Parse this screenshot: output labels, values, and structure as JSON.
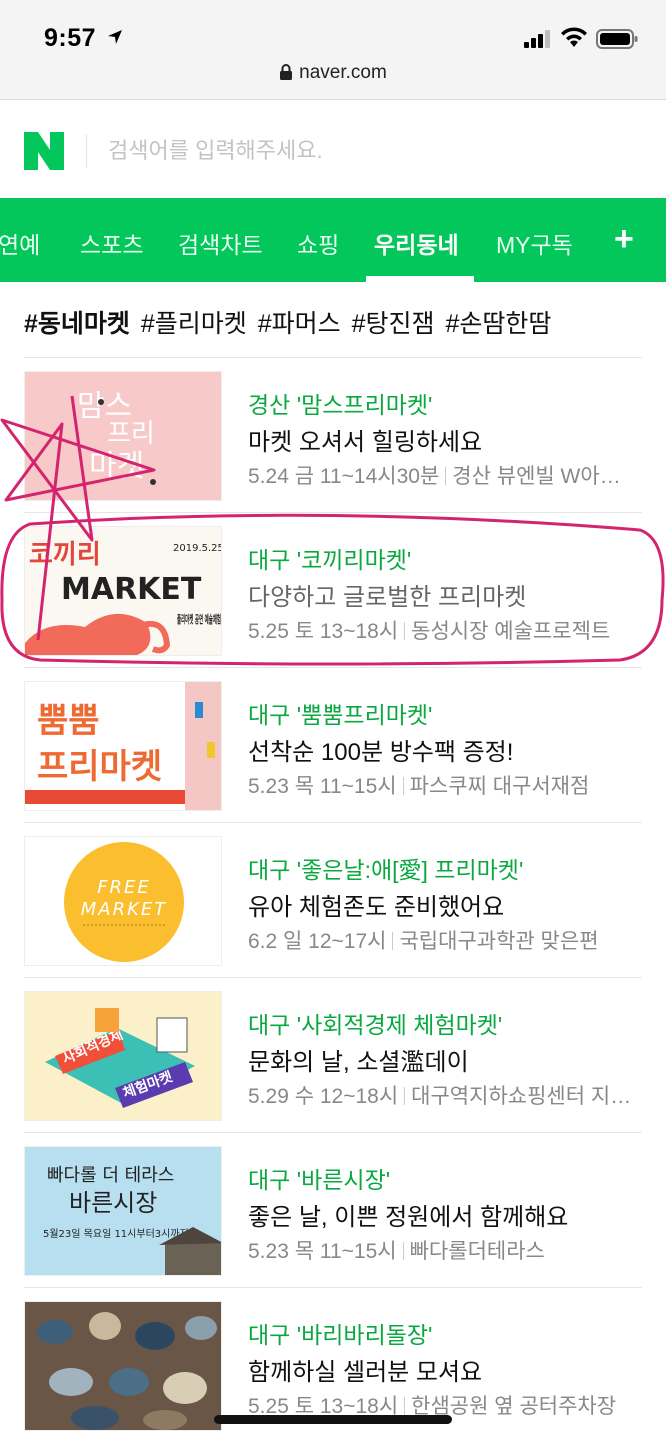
{
  "status": {
    "time": "9:57"
  },
  "browser": {
    "url": "naver.com"
  },
  "search": {
    "placeholder": "검색어를 입력해주세요."
  },
  "tabs": [
    {
      "label": "연예"
    },
    {
      "label": "스포츠"
    },
    {
      "label": "검색차트"
    },
    {
      "label": "쇼핑"
    },
    {
      "label": "우리동네",
      "active": true
    },
    {
      "label": "MY구독"
    }
  ],
  "add_tab": "+",
  "hashtags": [
    "#동네마켓",
    "#플리마켓",
    "#파머스",
    "#탕진잼",
    "#손땀한땀"
  ],
  "items": [
    {
      "title": "경산 '맘스프리마켓'",
      "desc": "마켓 오셔서 힐링하세요",
      "date": "5.24 금 11~14시30분",
      "place": "경산 뷰엔빌 W아…",
      "thumb": {
        "lines": [
          "맘스",
          "프리",
          "마켓"
        ]
      }
    },
    {
      "title": "대구 '코끼리마켓'",
      "desc": "다양하고 글로벌한 프리마켓",
      "date": "5.25 토 13~18시",
      "place": "동성시장 예술프로젝트",
      "thumb": {
        "line1": "코끼리",
        "line2": "MARKET",
        "date": "2019.5.25",
        "side": "플리마켓 공연 예술체험"
      }
    },
    {
      "title": "대구 '뿜뿜프리마켓'",
      "desc": "선착순 100분 방수팩 증정!",
      "date": "5.23 목 11~15시",
      "place": "파스쿠찌 대구서재점",
      "thumb": {
        "line1": "뿜뿜",
        "line2": "프리마켓"
      }
    },
    {
      "title": "대구 '좋은날:애[愛] 프리마켓'",
      "desc": "유아 체험존도 준비했어요",
      "date": "6.2 일 12~17시",
      "place": "국립대구과학관 맞은편",
      "thumb": {
        "line1": "FREE",
        "line2": "MARKET"
      }
    },
    {
      "title": "대구 '사회적경제 체험마켓'",
      "desc": "문화의 날, 소셜濫데이",
      "date": "5.29 수 12~18시",
      "place": "대구역지하쇼핑센터 지…",
      "thumb": {
        "line1": "사회적경제",
        "line2": "체험마켓"
      }
    },
    {
      "title": "대구 '바른시장'",
      "desc": "좋은 날, 이쁜 정원에서 함께해요",
      "date": "5.23 목 11~15시",
      "place": "빠다롤더테라스",
      "thumb": {
        "line1": "빠다롤 더 테라스",
        "line2": "바른시장",
        "line3": "5월23일 목요일 11시부터3시까지"
      }
    },
    {
      "title": "대구 '바리바리돌장'",
      "desc": "함께하실 셀러분 모셔요",
      "date": "5.25 토 13~18시",
      "place": "한샘공원 옆 공터주차장"
    }
  ],
  "colors": {
    "naver_green": "#03c75a",
    "title_green": "#0aa940",
    "annotation": "#d4246e"
  }
}
